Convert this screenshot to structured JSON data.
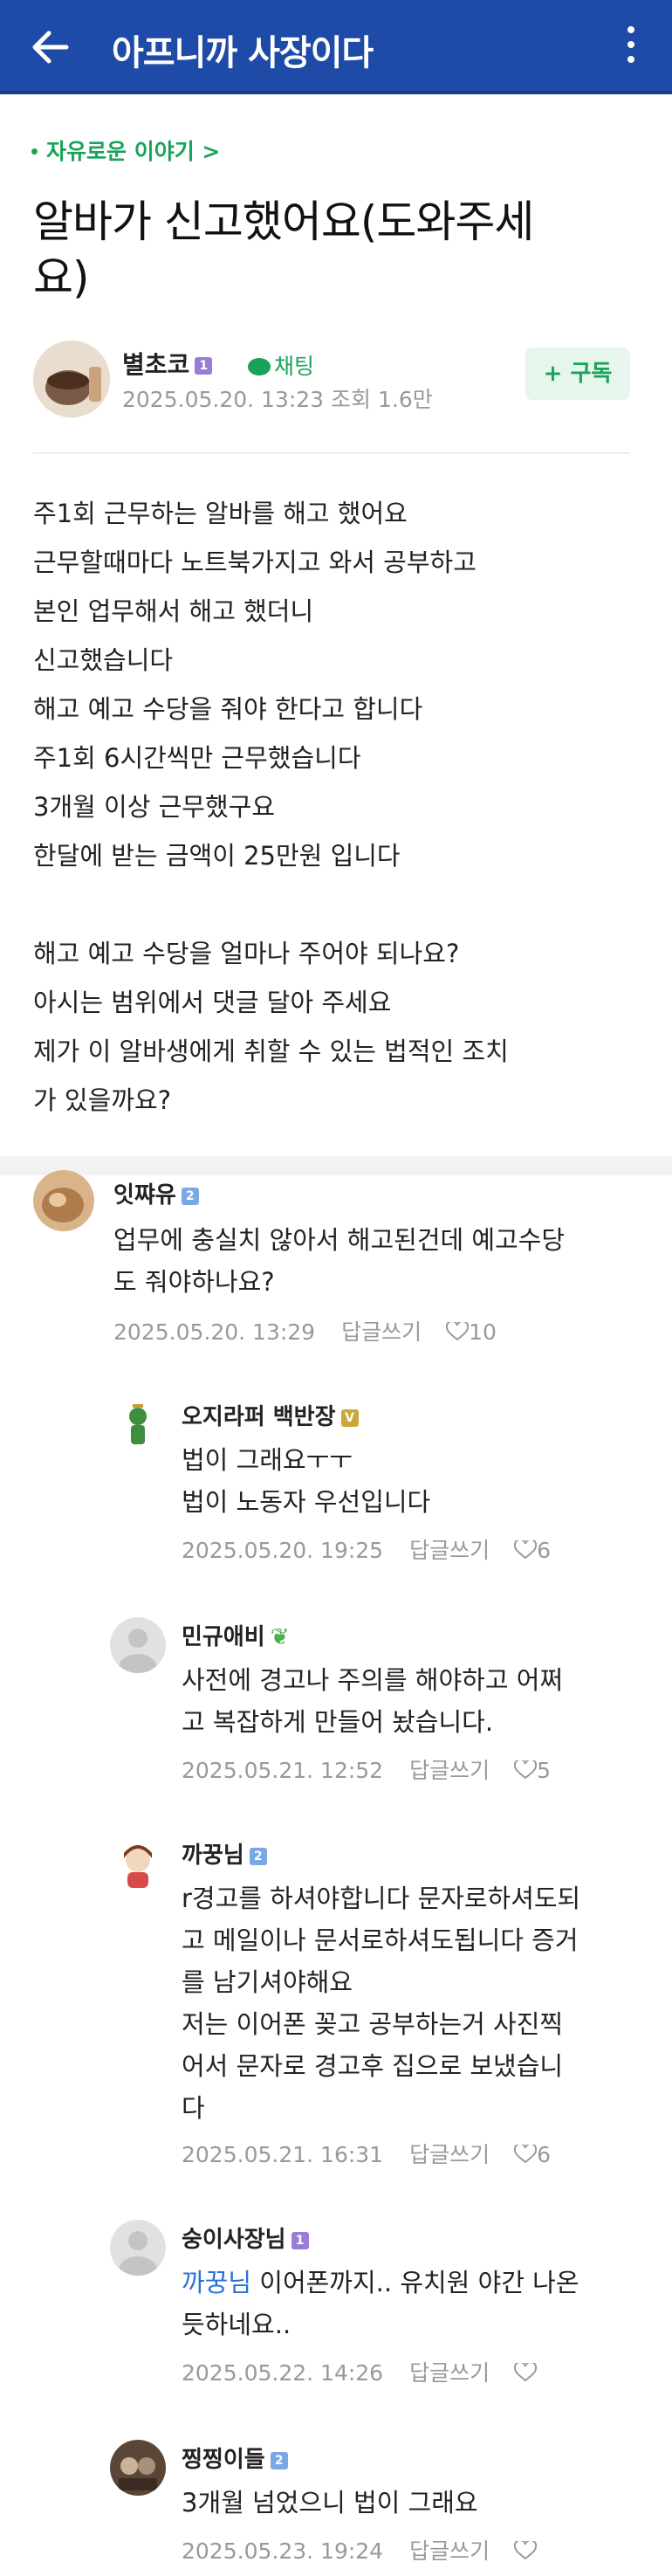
{
  "header": {
    "title": "아프니까 사장이다"
  },
  "post": {
    "category": "자유로운 이야기 >",
    "title_lines": [
      "알바가 신고했어요(도와주세",
      "요)"
    ],
    "author": "별초코",
    "author_badge": "1",
    "chat_label": "채팅",
    "meta": "2025.05.20. 13:23  조회 1.6만",
    "subscribe_label": "+ 구독",
    "body": [
      "주1회   근무하는  알바를   해고  했어요",
      "근무할때마다   노트북가지고   와서   공부하고",
      "본인  업무해서   해고  했더니",
      "신고했습니다",
      "해고  예고  수당을   줘야   한다고  합니다",
      "주1회  6시간씩만   근무했습니다",
      "3개월  이상  근무했구요",
      "한달에  받는  금액이   25만원  입니다",
      "",
      "해고 예고  수당을   얼마나  주어야   되나요?",
      "아시는  범위에서  댓글  달아  주세요",
      "제가   이 알바생에게   취할  수  있는  법적인  조치",
      "가  있을까요?"
    ]
  },
  "comments": [
    {
      "name": "잇쨔유",
      "badge": "2",
      "lines": [
        "업무에 충실치 않아서 해고된건데 예고수당",
        "도 줘야하나요?"
      ],
      "date": "2025.05.20. 13:29",
      "reply_label": "답글쓰기",
      "likes": "10"
    },
    {
      "name": "오지라퍼 백반장",
      "badge": "V",
      "lines": [
        "법이 그래요ㅜㅜ",
        "법이 노동자 우선입니다"
      ],
      "date": "2025.05.20. 19:25",
      "reply_label": "답글쓰기",
      "likes": "6"
    },
    {
      "name": "민규애비",
      "badge": "",
      "lines": [
        "사전에 경고나 주의를 해야하고 어쩌",
        "고 복잡하게 만들어 놨습니다."
      ],
      "date": "2025.05.21. 12:52",
      "reply_label": "답글쓰기",
      "likes": "5"
    },
    {
      "name": "까꿍님",
      "badge": "2",
      "lines": [
        "r경고를 하셔야합니다 문자로하셔도되",
        "고 메일이나 문서로하셔도됩니다 증거",
        "를 남기셔야해요",
        "저는 이어폰 꽂고 공부하는거 사진찍",
        "어서 문자로 경고후 집으로 보냈습니",
        "다"
      ],
      "date": "2025.05.21. 16:31",
      "reply_label": "답글쓰기",
      "likes": "6"
    },
    {
      "name": "숭이사장님",
      "badge": "1",
      "mention": "까꿍님",
      "lines": [
        " 이어폰까지.. 유치원 야간 나온",
        "듯하네요.."
      ],
      "date": "2025.05.22. 14:26",
      "reply_label": "답글쓰기",
      "likes": ""
    },
    {
      "name": "찡찡이들",
      "badge": "2",
      "lines": [
        "3개월 넘었으니 법이 그래요"
      ],
      "date": "2025.05.23. 19:24",
      "reply_label": "답글쓰기",
      "likes": ""
    }
  ],
  "colors": {
    "header_bg": "#1f4ba8",
    "accent_green": "#18a35a",
    "mention_blue": "#2c6fd6",
    "meta_gray": "#999999"
  },
  "icons": {
    "back": "arrow-left-icon",
    "more": "vertical-dots-icon",
    "chat": "chat-bubble-icon",
    "like": "heart-outline-icon"
  }
}
